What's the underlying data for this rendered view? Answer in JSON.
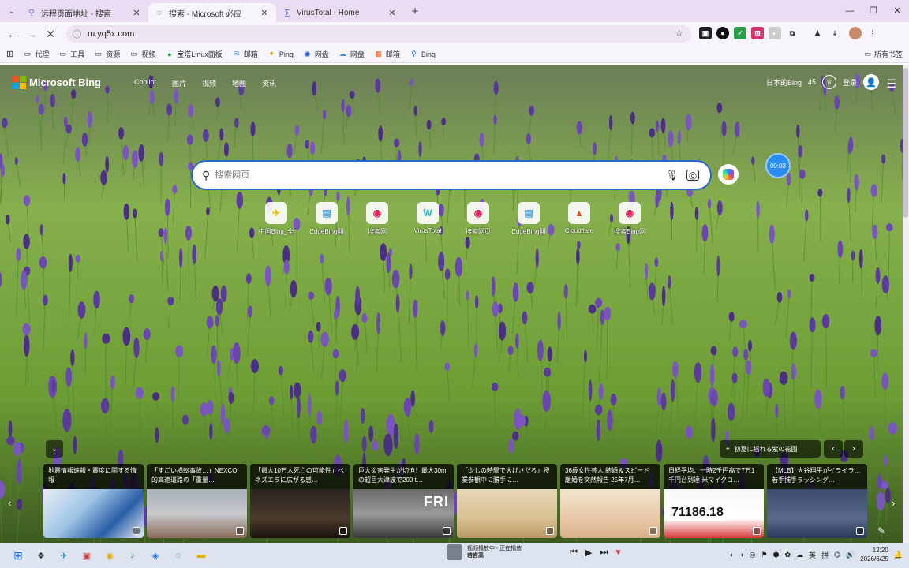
{
  "browser": {
    "tabs": [
      {
        "title": "远程页面地址 - 搜索",
        "icon": "search-favicon",
        "active": false
      },
      {
        "title": "搜索 - Microsoft 必应",
        "icon": "loading-favicon",
        "active": true
      },
      {
        "title": "VirusTotal - Home",
        "icon": "virustotal-favicon",
        "active": false
      }
    ],
    "new_tab": "+",
    "window_controls": {
      "min": "—",
      "restore": "❐",
      "close": "✕"
    },
    "nav": {
      "back": "←",
      "forward": "→",
      "stop": "✕"
    },
    "omnibox": {
      "url": "m.yq5x.com"
    },
    "bookmarks": [
      {
        "label": "代理",
        "icon": "folder-icon"
      },
      {
        "label": "工具",
        "icon": "folder-icon"
      },
      {
        "label": "资源",
        "icon": "folder-icon"
      },
      {
        "label": "视频",
        "icon": "folder-icon"
      },
      {
        "label": "宝塔Linux面板",
        "icon": "baota-icon"
      },
      {
        "label": "邮箱",
        "icon": "mail-icon"
      },
      {
        "label": "Ping",
        "icon": "ping-icon"
      },
      {
        "label": "网盘",
        "icon": "cloud-icon"
      },
      {
        "label": "网盘",
        "icon": "cloud-icon"
      },
      {
        "label": "邮箱",
        "icon": "windows-icon"
      },
      {
        "label": "Bing",
        "icon": "search-icon"
      }
    ],
    "all_bookmarks": "所有书签"
  },
  "bing": {
    "logo_text": "Microsoft Bing",
    "nav": [
      "Copilot",
      "图片",
      "视频",
      "地图",
      "资讯"
    ],
    "region": "日本的Bing",
    "points": "45",
    "sign_in": "登录",
    "search": {
      "placeholder": "搜索网页"
    },
    "timer": "00:03",
    "quick_access": [
      {
        "label": "中国Bing_全",
        "glyph": "✈",
        "color": "#f6c500"
      },
      {
        "label": "EdgeBing翻",
        "glyph": "▤",
        "color": "#4aa3df"
      },
      {
        "label": "搜索网",
        "glyph": "◉",
        "color": "#e0245e"
      },
      {
        "label": "VirusTotal",
        "glyph": "W",
        "color": "#1fbfbf"
      },
      {
        "label": "搜索网页",
        "glyph": "◉",
        "color": "#e0245e"
      },
      {
        "label": "EdgeBing翻",
        "glyph": "▤",
        "color": "#4aa3df"
      },
      {
        "label": "Cloudflare",
        "glyph": "▲",
        "color": "#e0521e"
      },
      {
        "label": "搜索Bing网",
        "glyph": "◉",
        "color": "#e0245e"
      }
    ],
    "location_label": "初夏に揺れる紫の花園",
    "news": [
      {
        "title": "地震情報速報・震度に関する情報",
        "img": "map"
      },
      {
        "title": "「すごい横転事故…」NEXCO的高速道路の「重量…",
        "img": "traffic"
      },
      {
        "title": "「最大10万人死亡の可能性」ベネズエラに広がる感…",
        "img": "dark"
      },
      {
        "title": "巨大災害発生が切迫！最大30mの超巨大津波で200 t…",
        "img": "fri",
        "badge": "FRI"
      },
      {
        "title": "「少しの時間で大げさだろ」授業参観中に勝手に…",
        "img": "cartoon"
      },
      {
        "title": "36歳女性芸人 結婚＆スピード離婚を突然報告 25年7月…",
        "img": "face"
      },
      {
        "title": "日経平均、一時2千円高で7万1千円台到達 米マイクロ…",
        "img": "stock",
        "number": "71186.18"
      },
      {
        "title": "【MLB】大谷翔平がイライラ…若手捕手ラッシング…",
        "img": "baseball"
      }
    ]
  },
  "taskbar": {
    "media_title": "视频播放中 - 正在播放",
    "media_sub": "若宫高",
    "ime": "英",
    "ime2": "拼",
    "time": "12:20",
    "date": "2026/6/25"
  }
}
